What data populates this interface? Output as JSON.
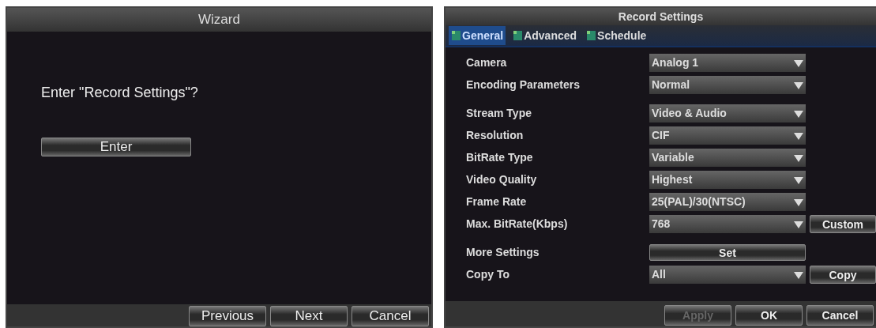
{
  "wizard": {
    "title": "Wizard",
    "prompt": "Enter \"Record Settings\"?",
    "action_button": "Enter",
    "buttons": [
      {
        "label": "Previous"
      },
      {
        "label": "Next"
      },
      {
        "label": "Cancel"
      }
    ]
  },
  "record_settings": {
    "title": "Record Settings",
    "tabs": [
      {
        "label": "General",
        "selected": true
      },
      {
        "label": "Advanced",
        "selected": false
      },
      {
        "label": "Schedule",
        "selected": false
      }
    ],
    "sections": [
      [
        {
          "kind": "select",
          "label": "Camera",
          "value": "Analog 1"
        },
        {
          "kind": "select",
          "label": "Encoding Parameters",
          "value": "Normal"
        }
      ],
      [
        {
          "kind": "select",
          "label": "Stream Type",
          "value": "Video & Audio"
        },
        {
          "kind": "select",
          "label": "Resolution",
          "value": "CIF"
        },
        {
          "kind": "select",
          "label": "BitRate Type",
          "value": "Variable"
        },
        {
          "kind": "select",
          "label": "Video Quality",
          "value": "Highest"
        },
        {
          "kind": "select",
          "label": "Frame Rate",
          "value": "25(PAL)/30(NTSC)"
        },
        {
          "kind": "select",
          "label": "Max. BitRate(Kbps)",
          "value": "768",
          "button": "Custom"
        }
      ],
      [
        {
          "kind": "button",
          "label": "More Settings",
          "value": "Set"
        },
        {
          "kind": "select",
          "label": "Copy To",
          "value": "All",
          "button": "Copy"
        }
      ]
    ],
    "buttons": [
      {
        "label": "Apply",
        "disabled": true
      },
      {
        "label": "OK",
        "disabled": false
      },
      {
        "label": "Cancel",
        "disabled": false
      }
    ]
  }
}
